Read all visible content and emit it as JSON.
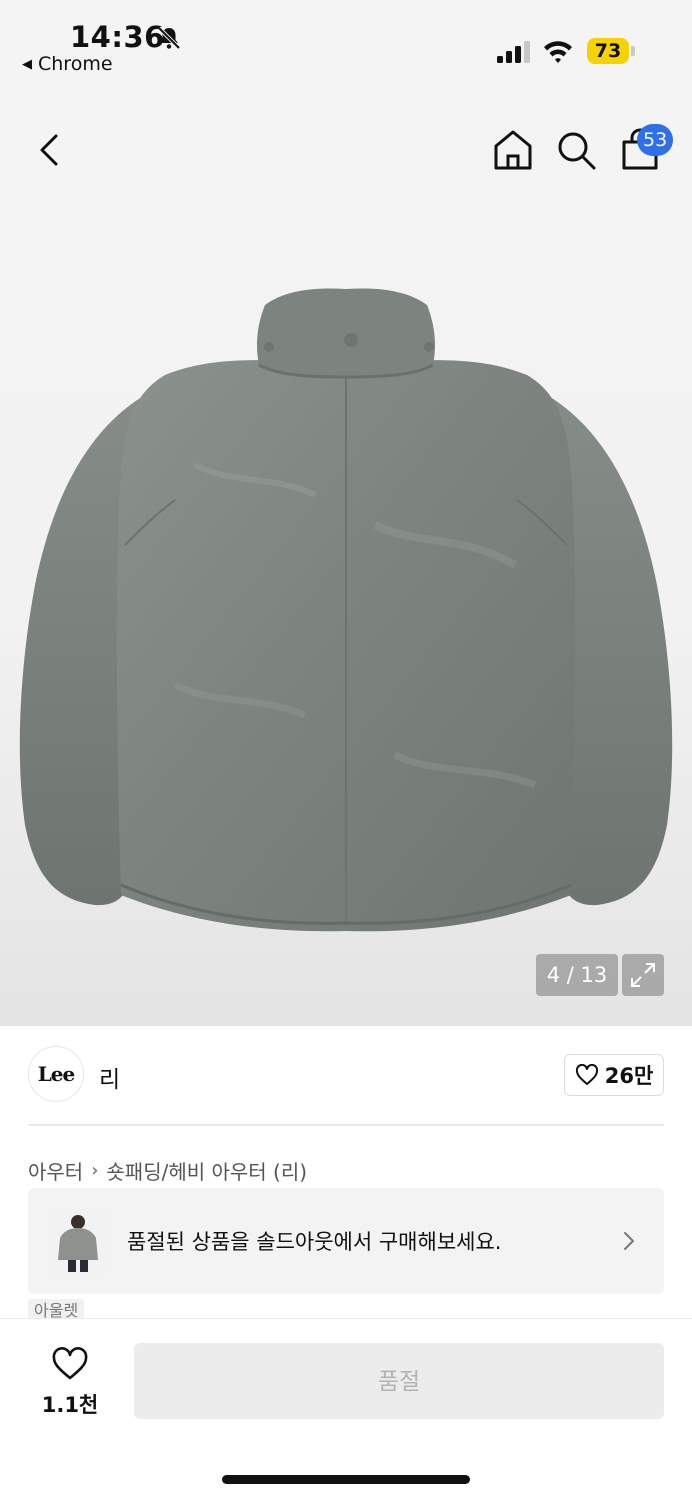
{
  "status_bar": {
    "time": "14:36",
    "back_app": "Chrome",
    "battery": "73",
    "battery_color": "#f5d200"
  },
  "nav": {
    "cart_count": "53",
    "badge_color": "#2f6fe8"
  },
  "gallery": {
    "counter": "4 / 13"
  },
  "brand": {
    "logo_text": "Lee",
    "name": "리",
    "likes": "26만"
  },
  "breadcrumb": {
    "category": "아우터",
    "subcategory": "숏패딩/헤비 아우터 (리)"
  },
  "soldout_banner": {
    "text": "품절된 상품을 솔드아웃에서 구매해보세요."
  },
  "tags": {
    "outlet": "아울렛"
  },
  "bottom_bar": {
    "wish_count": "1.1천",
    "buy_label": "품절"
  },
  "icons": {
    "status": [
      "bell-muted-icon",
      "signal-icon",
      "wifi-icon",
      "battery-icon"
    ],
    "nav": [
      "chevron-left-icon",
      "home-icon",
      "search-icon",
      "shopping-bag-icon"
    ],
    "gallery": [
      "expand-icon"
    ],
    "other": [
      "heart-icon",
      "chevron-right-icon"
    ]
  }
}
